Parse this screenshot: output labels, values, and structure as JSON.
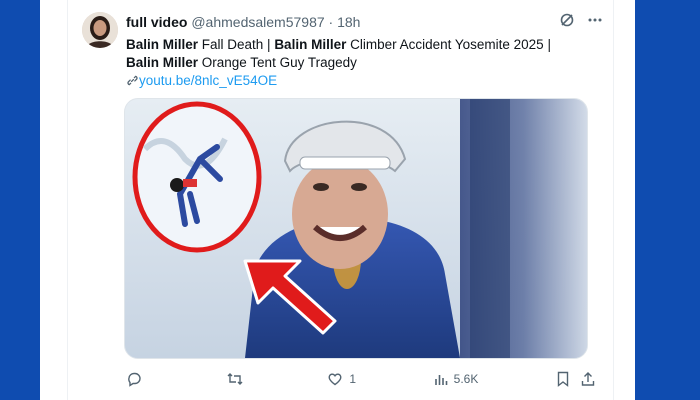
{
  "tweet": {
    "display_name": "full video",
    "handle": "@ahmedsalem57987",
    "separator": "·",
    "time": "18h",
    "text": {
      "part1_bold": "Balin Miller",
      "part1": " Fall Death | ",
      "part2_bold": "Balin Miller",
      "part2": " Climber Accident Yosemite 2025 |",
      "part3_bold": "Balin Miller",
      "part3": " Orange Tent Guy Tragedy",
      "link": "youtu.be/8nlc_vE54OE"
    }
  },
  "actions": {
    "reply_count": "",
    "retweet_count": "",
    "like_count": "1",
    "views_count": "5.6K"
  },
  "icons": {
    "grok": "grok-icon",
    "more": "more-icon",
    "reply": "reply-icon",
    "retweet": "retweet-icon",
    "like": "heart-icon",
    "views": "views-icon",
    "bookmark": "bookmark-icon",
    "share": "share-icon",
    "link": "link-icon"
  },
  "colors": {
    "background": "#0d47a1",
    "link": "#1d9bf0",
    "muted": "#536471",
    "text": "#0f1419",
    "highlight": "#e01b1b"
  }
}
